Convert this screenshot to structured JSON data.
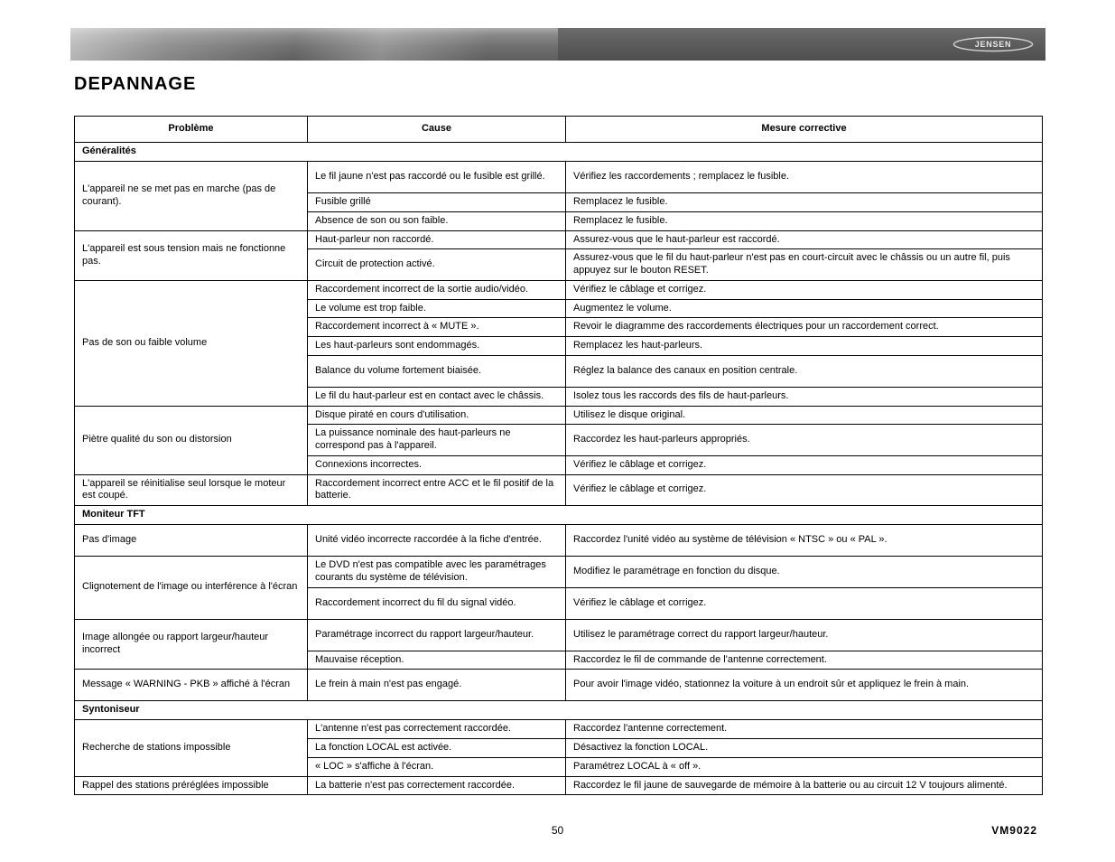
{
  "brand": "JENSEN",
  "title": "DEPANNAGE",
  "columns": [
    "Problème",
    "Cause",
    "Mesure corrective"
  ],
  "sections": [
    {
      "name": "Généralités",
      "rows": [
        {
          "problem": "L'appareil ne se met pas en marche (pas de courant).",
          "pairs": [
            {
              "cause": "Le fil jaune n'est pas raccordé ou le fusible est grillé.",
              "fix": "Vérifiez les raccordements ; remplacez le fusible.",
              "tall": true
            },
            {
              "cause": "Fusible grillé",
              "fix": "Remplacez le fusible."
            },
            {
              "cause": "Absence de son ou son faible.",
              "fix": "Remplacez le fusible."
            }
          ]
        },
        {
          "problem": "L'appareil est sous tension mais ne fonctionne pas.",
          "pairs": [
            {
              "cause": "Haut-parleur non raccordé.",
              "fix": "Assurez-vous que le haut-parleur est raccordé."
            },
            {
              "cause": "Circuit de protection activé.",
              "fix": "Assurez-vous que le fil du haut-parleur n'est pas en court-circuit avec le châssis ou un autre fil, puis appuyez sur le bouton RESET."
            }
          ]
        },
        {
          "problem": "Pas de son ou faible volume",
          "pairs": [
            {
              "cause": "Raccordement incorrect de la sortie audio/vidéo.",
              "fix": "Vérifiez le câblage et corrigez."
            },
            {
              "cause": "Le volume est trop faible.",
              "fix": "Augmentez le volume."
            },
            {
              "cause": "Raccordement incorrect à « MUTE ».",
              "fix": "Revoir le diagramme des raccordements électriques pour un raccordement correct."
            },
            {
              "cause": "Les haut-parleurs sont endommagés.",
              "fix": "Remplacez les haut-parleurs."
            },
            {
              "cause": "Balance du volume fortement biaisée.",
              "fix": "Réglez la balance des canaux en position centrale.",
              "tall": true
            },
            {
              "cause": "Le fil du haut-parleur est en contact avec le châssis.",
              "fix": "Isolez tous les raccords des fils de haut-parleurs."
            }
          ]
        },
        {
          "problem": "Piètre qualité du son ou distorsion",
          "pairs": [
            {
              "cause": "Disque piraté en cours d'utilisation.",
              "fix": "Utilisez le disque original."
            },
            {
              "cause": "La puissance nominale des haut-parleurs ne correspond pas à l'appareil.",
              "fix": "Raccordez les haut-parleurs appropriés."
            },
            {
              "cause": "Connexions incorrectes.",
              "fix": "Vérifiez le câblage et corrigez."
            }
          ]
        },
        {
          "problem": "L'appareil se réinitialise seul lorsque le moteur est coupé.",
          "pairs": [
            {
              "cause": "Raccordement incorrect entre ACC et le fil positif de la batterie.",
              "fix": "Vérifiez le câblage et corrigez."
            }
          ]
        }
      ]
    },
    {
      "name": "Moniteur TFT",
      "rows": [
        {
          "problem": "Pas d'image",
          "pairs": [
            {
              "cause": "Unité vidéo incorrecte raccordée à la fiche d'entrée.",
              "fix": "Raccordez l'unité vidéo au système de télévision « NTSC » ou « PAL ».",
              "tall": true
            }
          ]
        },
        {
          "problem": "Clignotement de l'image ou interférence à l'écran",
          "pairs": [
            {
              "cause": "Le DVD n'est pas compatible avec les paramétrages courants du système de télévision.",
              "fix": "Modifiez le paramétrage en fonction du disque."
            },
            {
              "cause": "Raccordement incorrect du fil du signal vidéo.",
              "fix": "Vérifiez le câblage et corrigez.",
              "tall": true
            }
          ]
        },
        {
          "problem": "Image allongée ou rapport largeur/hauteur incorrect",
          "pairs": [
            {
              "cause": "Paramétrage incorrect du rapport largeur/hauteur.",
              "fix": "Utilisez le paramétrage correct du rapport largeur/hauteur.",
              "tall": true
            },
            {
              "cause": "Mauvaise réception.",
              "fix": "Raccordez le fil de commande de l'antenne correctement."
            }
          ]
        },
        {
          "problem": "Message « WARNING - PKB » affiché à l'écran",
          "pairs": [
            {
              "cause": "Le frein à main n'est pas engagé.",
              "fix": "Pour avoir l'image vidéo, stationnez la voiture à un endroit sûr et appliquez le frein à main.",
              "tall": true
            }
          ]
        }
      ]
    },
    {
      "name": "Syntoniseur",
      "rows": [
        {
          "problem": "Recherche de stations impossible",
          "pairs": [
            {
              "cause": "L'antenne n'est pas correctement raccordée.",
              "fix": "Raccordez l'antenne correctement."
            },
            {
              "cause": "La fonction LOCAL est activée.",
              "fix": "Désactivez la fonction LOCAL."
            },
            {
              "cause": "« LOC » s'affiche à l'écran.",
              "fix": "Paramétrez LOCAL à « off »."
            }
          ]
        },
        {
          "problem": "Rappel des stations préréglées impossible",
          "pairs": [
            {
              "cause": "La batterie n'est pas correctement raccordée.",
              "fix": "Raccordez le fil jaune de sauvegarde de mémoire à la batterie ou au circuit 12 V toujours alimenté."
            }
          ]
        }
      ]
    }
  ],
  "page_number": "50",
  "model": "VM9022"
}
